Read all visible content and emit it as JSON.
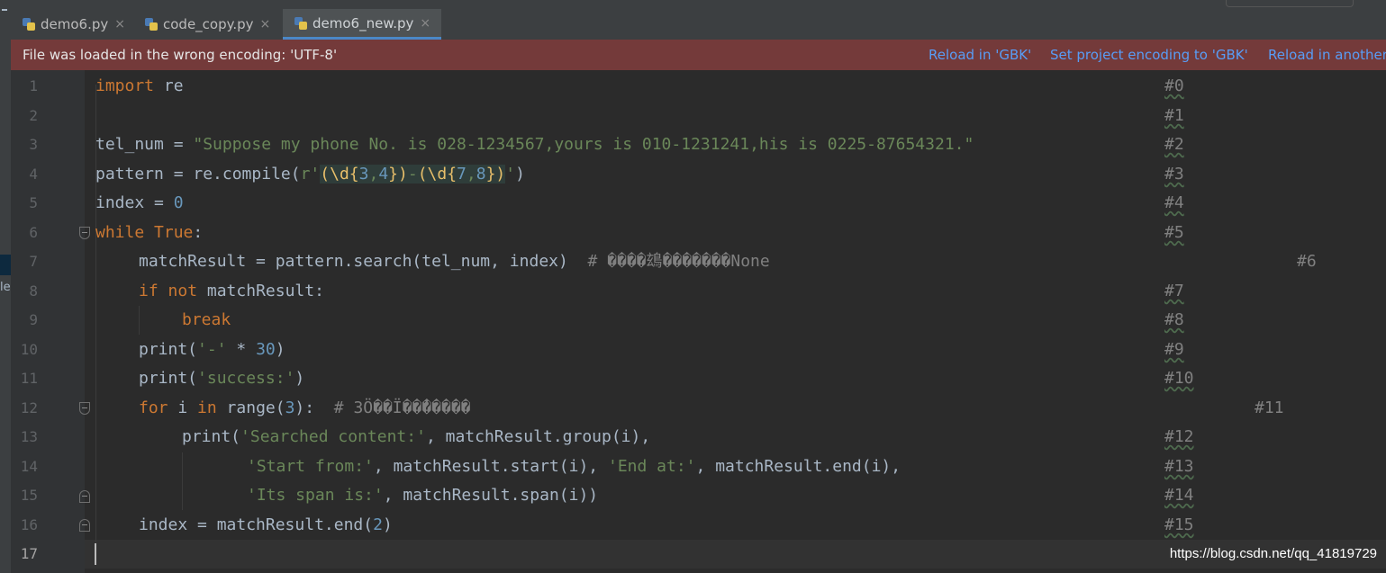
{
  "tabs": [
    {
      "label": "demo6.py",
      "close": "×"
    },
    {
      "label": "code_copy.py",
      "close": "×"
    },
    {
      "label": "demo6_new.py",
      "close": "×"
    }
  ],
  "left_panel": {
    "fragment": "le"
  },
  "banner": {
    "message": "File was loaded in the wrong encoding: 'UTF-8'",
    "reload_gbk": "Reload in 'GBK'",
    "set_encoding": "Set project encoding to 'GBK'",
    "reload_other": "Reload in another"
  },
  "line_numbers": [
    "1",
    "2",
    "3",
    "4",
    "5",
    "6",
    "7",
    "8",
    "9",
    "10",
    "11",
    "12",
    "13",
    "14",
    "15",
    "16",
    "17"
  ],
  "code": {
    "l1": {
      "kw": "import",
      "rest": " re"
    },
    "l3": {
      "a": "tel_num = ",
      "s": "\"Suppose my phone No. is 028-1234567,yours is 010-1231241,his is 0225-87654321.\""
    },
    "l4": {
      "a": "pattern = re.compile(",
      "p": "r'",
      "g1": "(\\d{",
      "n1": "3",
      "c1": ",",
      "n2": "4",
      "g2": "})",
      "dash": "-",
      "g3": "(\\d{",
      "n3": "7",
      "c2": ",",
      "n4": "8",
      "g4": "})",
      "q": "'",
      "b": ")"
    },
    "l5": {
      "a": "index = ",
      "n": "0"
    },
    "l6": {
      "kw": "while",
      "sp": " ",
      "kw2": "True",
      "b": ":"
    },
    "l7": {
      "a": "matchResult = pattern.search(tel_num, index)  ",
      "c": "# ����䲻�������None"
    },
    "l8": {
      "kw": "if",
      "sp": " ",
      "kw2": "not",
      "b": " matchResult:"
    },
    "l9": {
      "kw": "break"
    },
    "l10": {
      "a": "print(",
      "s": "'-'",
      "b": " * ",
      "n": "30",
      "c": ")"
    },
    "l11": {
      "a": "print(",
      "s": "'success:'",
      "b": ")"
    },
    "l12": {
      "kw": "for",
      "a": " i ",
      "kw2": "in",
      "b": " range(",
      "n": "3",
      "c": "):  ",
      "cm": "# 3Ö��Ï��̽�����"
    },
    "l13": {
      "a": "print(",
      "s": "'Searched content:'",
      "b": ", matchResult.group(i),"
    },
    "l14": {
      "s": "'Start from:'",
      "b": ", matchResult.start(i), ",
      "s2": "'End at:'",
      "c": ", matchResult.end(i),"
    },
    "l15": {
      "s": "'Its span is:'",
      "b": ", matchResult.span(i))"
    },
    "l16": {
      "a": "index = matchResult.end(",
      "n": "2",
      "b": ")"
    }
  },
  "markers": [
    "#0",
    "#1",
    "#2",
    "#3",
    "#4",
    "#5",
    "#6",
    "#7",
    "#8",
    "#9",
    "#10",
    "#11",
    "#12",
    "#13",
    "#14",
    "#15"
  ],
  "watermark": "https://blog.csdn.net/qq_41819729"
}
